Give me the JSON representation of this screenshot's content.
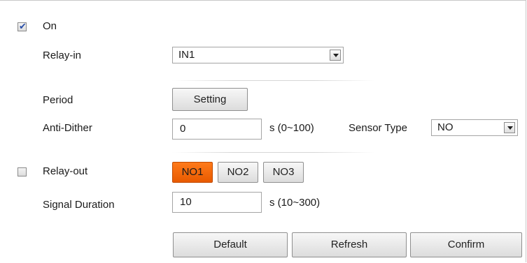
{
  "enable": {
    "label": "On",
    "checked": true
  },
  "relay_in": {
    "label": "Relay-in",
    "value": "IN1"
  },
  "period": {
    "label": "Period",
    "button": "Setting"
  },
  "anti_dither": {
    "label": "Anti-Dither",
    "value": "0",
    "unit": "s (0~100)"
  },
  "sensor_type": {
    "label": "Sensor Type",
    "value": "NO"
  },
  "relay_out": {
    "label": "Relay-out",
    "checked": false,
    "options": [
      "NO1",
      "NO2",
      "NO3"
    ],
    "selected": "NO1"
  },
  "signal_duration": {
    "label": "Signal Duration",
    "value": "10",
    "unit": "s (10~300)"
  },
  "footer": {
    "default": "Default",
    "refresh": "Refresh",
    "confirm": "Confirm"
  },
  "colors": {
    "accent": "#f26a0f"
  }
}
